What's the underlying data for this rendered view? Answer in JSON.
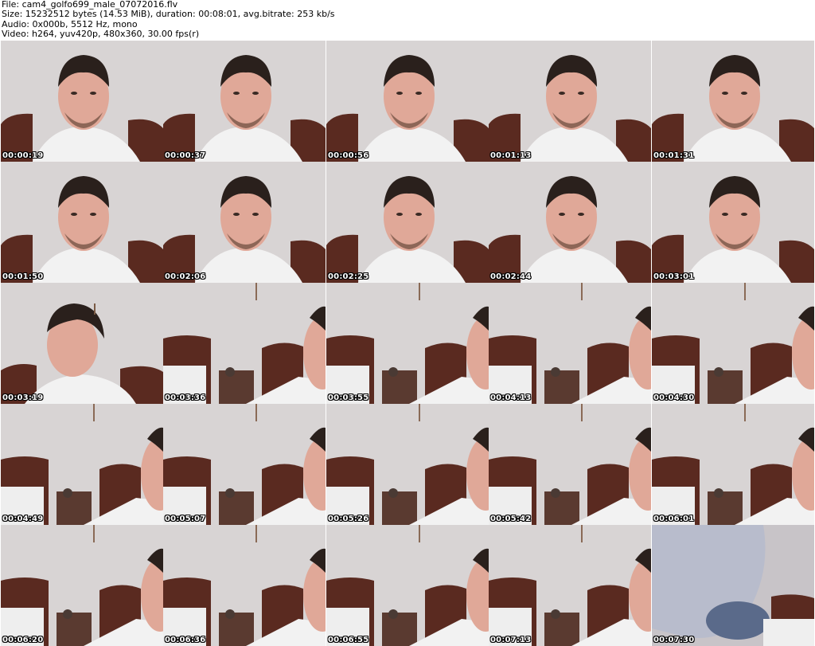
{
  "header": {
    "file": "File: cam4_golfo699_male_07072016.flv",
    "size": "Size: 15232512 bytes (14.53 MiB), duration: 00:08:01, avg.bitrate: 253 kb/s",
    "audio": "Audio: 0x000b, 5512 Hz, mono",
    "video": "Video: h264, yuv420p, 480x360, 30.00 fps(r)"
  },
  "thumbnails": [
    {
      "time": "00:00:19",
      "scene": "face-center"
    },
    {
      "time": "00:00:37",
      "scene": "face-center"
    },
    {
      "time": "00:00:56",
      "scene": "face-center"
    },
    {
      "time": "00:01:13",
      "scene": "face-center"
    },
    {
      "time": "00:01:31",
      "scene": "face-center"
    },
    {
      "time": "00:01:50",
      "scene": "face-center"
    },
    {
      "time": "00:02:06",
      "scene": "face-center"
    },
    {
      "time": "00:02:25",
      "scene": "face-center"
    },
    {
      "time": "00:02:44",
      "scene": "face-center"
    },
    {
      "time": "00:03:01",
      "scene": "face-center"
    },
    {
      "time": "00:03:19",
      "scene": "face-profile"
    },
    {
      "time": "00:03:36",
      "scene": "room-face-right"
    },
    {
      "time": "00:03:55",
      "scene": "room-face-right"
    },
    {
      "time": "00:04:13",
      "scene": "room-face-right"
    },
    {
      "time": "00:04:30",
      "scene": "room-face-right"
    },
    {
      "time": "00:04:49",
      "scene": "room-face-right"
    },
    {
      "time": "00:05:07",
      "scene": "room-face-right"
    },
    {
      "time": "00:05:26",
      "scene": "room-face-right"
    },
    {
      "time": "00:05:42",
      "scene": "room-face-right"
    },
    {
      "time": "00:06:01",
      "scene": "room-face-right"
    },
    {
      "time": "00:06:20",
      "scene": "room-face-right"
    },
    {
      "time": "00:06:36",
      "scene": "room-face-right"
    },
    {
      "time": "00:06:55",
      "scene": "room-face-right"
    },
    {
      "time": "00:07:13",
      "scene": "room-face-right"
    },
    {
      "time": "00:07:30",
      "scene": "closeup-blur"
    }
  ],
  "colors": {
    "wall": "#d8d4d4",
    "headboard": "#5a2a20",
    "skin": "#e0a898",
    "hair": "#2a201c",
    "shirt": "#f2f2f2"
  }
}
